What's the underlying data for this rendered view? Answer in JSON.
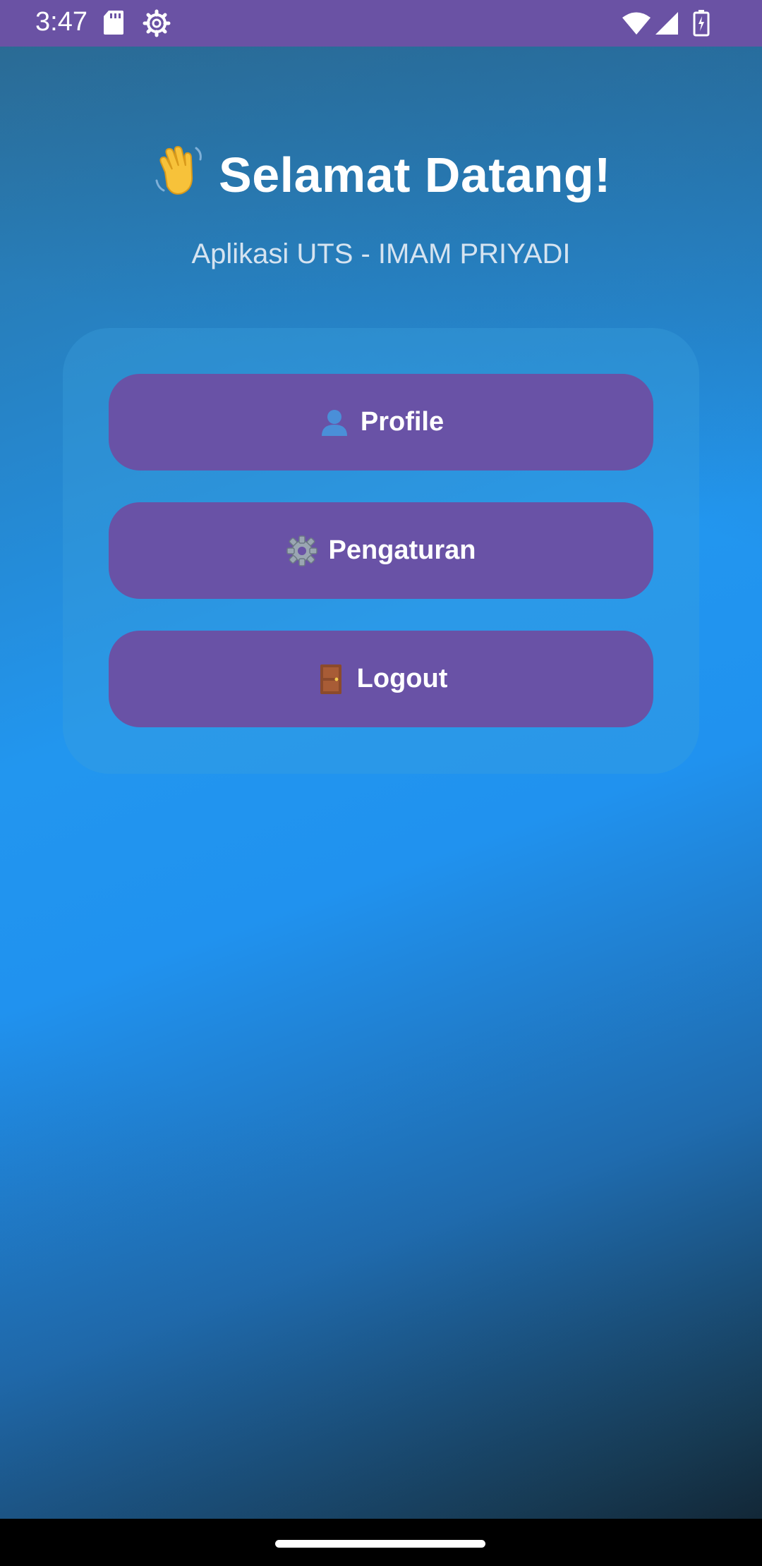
{
  "status_bar": {
    "time": "3:47",
    "background": "#6a52a4",
    "left_icons": [
      "sd-card-icon",
      "gear-notification-icon"
    ],
    "right_icons": [
      "wifi-icon",
      "signal-icon",
      "battery-icon"
    ]
  },
  "header": {
    "title_emoji": "waving-hand-icon",
    "title": "Selamat Datang!",
    "subtitle": "Aplikasi UTS - IMAM PRIYADI"
  },
  "menu": {
    "button_color": "#6952a6",
    "items": [
      {
        "icon": "person-icon",
        "label": "Profile"
      },
      {
        "icon": "gear-icon",
        "label": "Pengaturan"
      },
      {
        "icon": "door-icon",
        "label": "Logout"
      }
    ]
  },
  "colors": {
    "accent": "#6a52a4",
    "background_top": "#2b6f9a",
    "background_mid": "#2296ef",
    "background_bottom": "#0f1a22"
  }
}
